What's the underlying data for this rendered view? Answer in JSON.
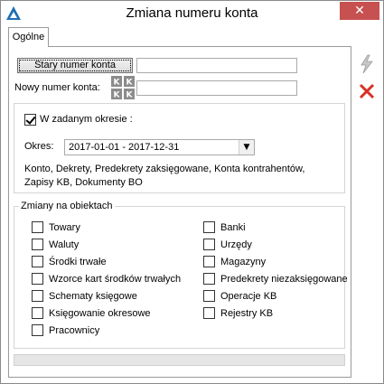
{
  "window": {
    "title": "Zmiana numeru konta",
    "close_glyph": "✕"
  },
  "tabs": [
    {
      "label": "Ogólne"
    }
  ],
  "account": {
    "old_button_label": "Stary numer konta",
    "old_value": "",
    "new_label": "Nowy numer konta:",
    "new_value": ""
  },
  "period": {
    "checkbox_label": "W zadanym okresie :",
    "checked": true,
    "okres_label": "Okres:",
    "okres_value": "2017-01-01 - 2017-12-31",
    "info_line1": "Konto, Dekrety, Predekrety zaksięgowane, Konta kontrahentów,",
    "info_line2": "Zapisy KB, Dokumenty BO"
  },
  "changes": {
    "title": "Zmiany na obiektach",
    "left": [
      {
        "label": "Towary",
        "checked": false
      },
      {
        "label": "Waluty",
        "checked": false
      },
      {
        "label": "Środki trwałe",
        "checked": false
      },
      {
        "label": "Wzorce kart środków trwałych",
        "checked": false
      },
      {
        "label": "Schematy księgowe",
        "checked": false
      },
      {
        "label": "Księgowanie okresowe",
        "checked": false
      },
      {
        "label": "Pracownicy",
        "checked": false
      }
    ],
    "right": [
      {
        "label": "Banki",
        "checked": false
      },
      {
        "label": "Urzędy",
        "checked": false
      },
      {
        "label": "Magazyny",
        "checked": false
      },
      {
        "label": "Predekrety niezaksięgowane",
        "checked": false
      },
      {
        "label": "Operacje KB",
        "checked": false
      },
      {
        "label": "Rejestry KB",
        "checked": false
      }
    ]
  },
  "icons": {
    "app": "app-logo-icon",
    "run": "lightning-run-icon",
    "cancel": "red-x-cancel-icon",
    "kk": "kk-account-picker-icon"
  },
  "colors": {
    "close_bg": "#c75050",
    "app_icon": "#1f6fb5",
    "cancel_red": "#d93025"
  }
}
